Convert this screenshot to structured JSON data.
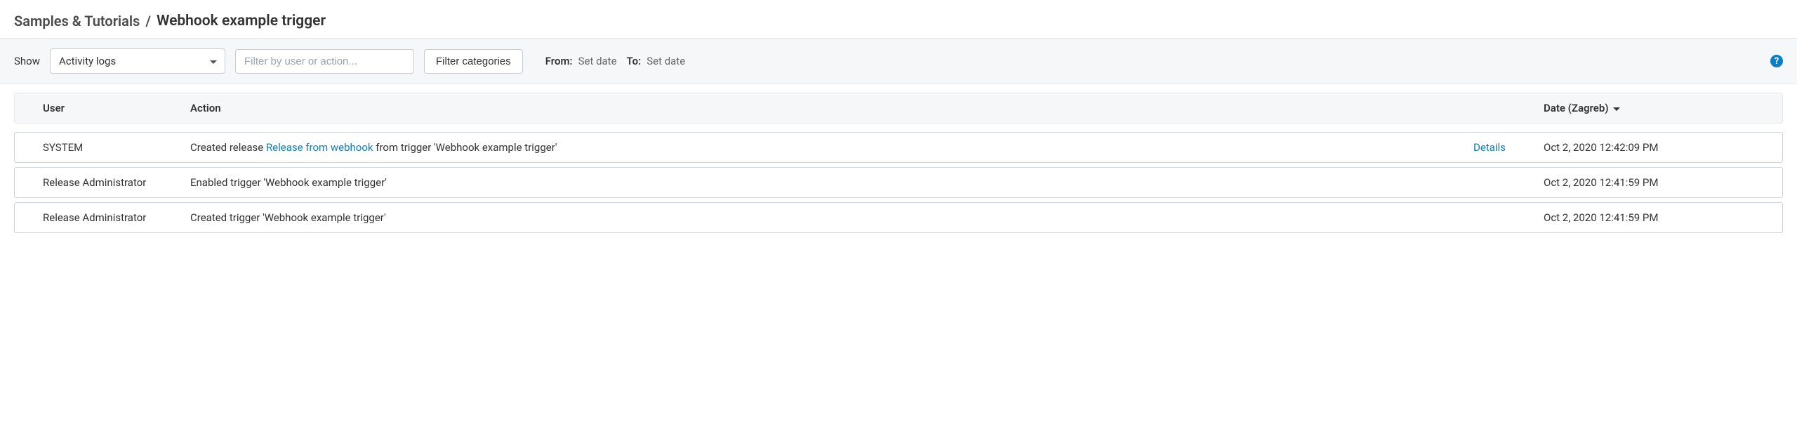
{
  "breadcrumb": {
    "parent": "Samples & Tutorials",
    "separator": "/",
    "current": "Webhook example trigger"
  },
  "filters": {
    "show_label": "Show",
    "show_value": "Activity logs",
    "filter_placeholder": "Filter by user or action...",
    "filter_categories_label": "Filter categories",
    "from_label": "From:",
    "from_value": "Set date",
    "to_label": "To:",
    "to_value": "Set date",
    "help_char": "?"
  },
  "table": {
    "headers": {
      "user": "User",
      "action": "Action",
      "date": "Date (Zagreb)"
    },
    "rows": [
      {
        "user": "SYSTEM",
        "action_prefix": "Created release ",
        "action_link": "Release from webhook",
        "action_suffix": " from trigger 'Webhook example trigger'",
        "details": "Details",
        "date": "Oct 2, 2020 12:42:09 PM"
      },
      {
        "user": "Release Administrator",
        "action_prefix": "Enabled trigger 'Webhook example trigger'",
        "action_link": "",
        "action_suffix": "",
        "details": "",
        "date": "Oct 2, 2020 12:41:59 PM"
      },
      {
        "user": "Release Administrator",
        "action_prefix": "Created trigger 'Webhook example trigger'",
        "action_link": "",
        "action_suffix": "",
        "details": "",
        "date": "Oct 2, 2020 12:41:59 PM"
      }
    ]
  }
}
